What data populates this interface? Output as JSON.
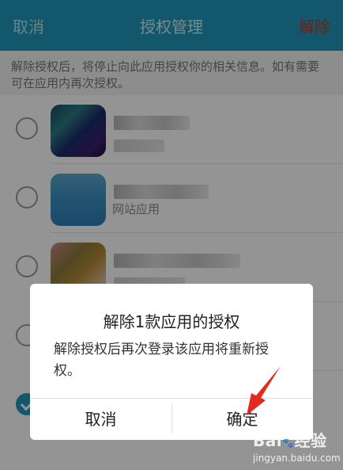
{
  "header": {
    "cancel_label": "取消",
    "title": "授权管理",
    "remove_label": "解除"
  },
  "notice": "解除授权后，将停止向此应用授权你的相关信息。如有需要可在应用内再次授权。",
  "app_list": [
    {
      "checked": false,
      "subtext": ""
    },
    {
      "checked": false,
      "subtext": "网站应用"
    },
    {
      "checked": false,
      "subtext": ""
    },
    {
      "checked": false,
      "subtext": ""
    },
    {
      "checked": true,
      "subtext": ""
    }
  ],
  "dialog": {
    "title": "解除1款应用的授权",
    "message": "解除授权后再次登录该应用将重新授权。",
    "cancel_label": "取消",
    "confirm_label": "确定"
  },
  "watermark": {
    "brand": "Bai",
    "brand_suffix": "经验",
    "site": "jingyan.baidu.com"
  },
  "colors": {
    "header_bg": "#1f97b8",
    "remove_text": "#c0392b",
    "checkbox_checked": "#1f97b8",
    "annotation_arrow": "#e32a1f"
  }
}
